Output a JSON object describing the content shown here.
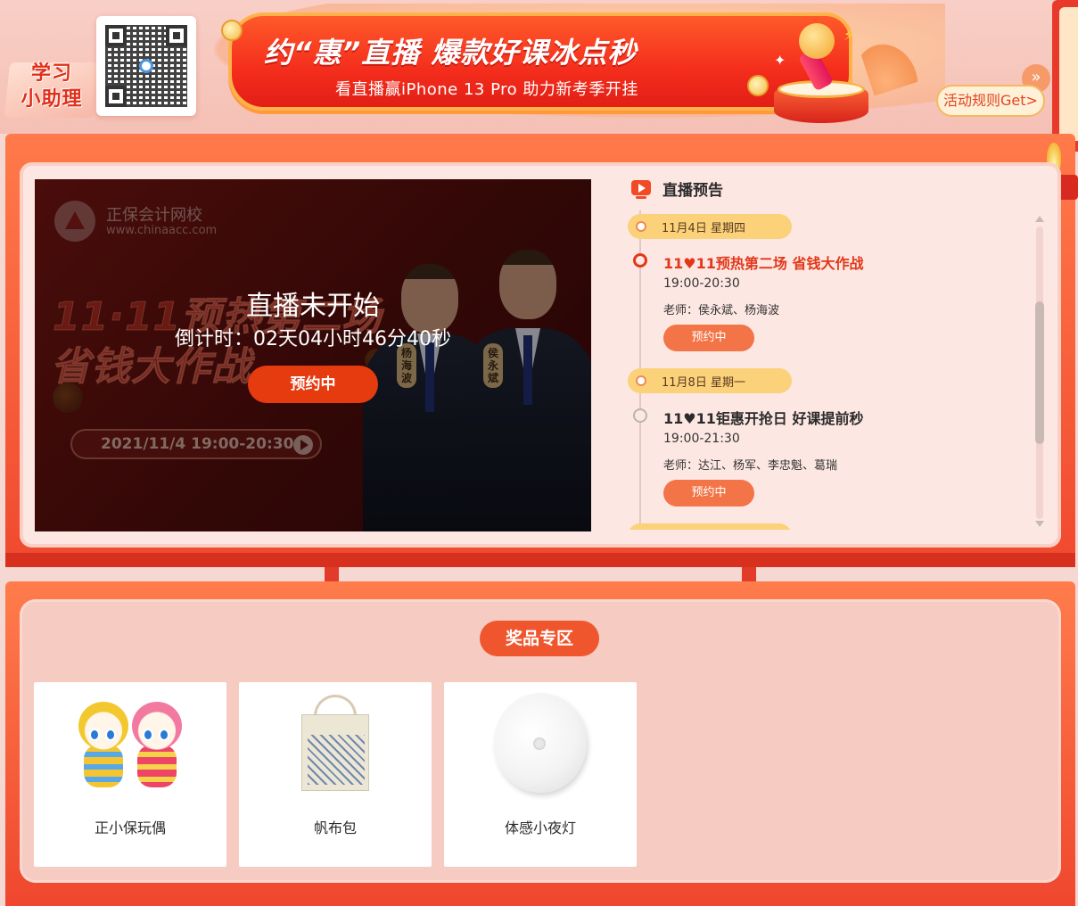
{
  "header": {
    "assistant_label": "学习\n小助理",
    "banner_title": "约“惠”直播 爆款好课冰点秒",
    "banner_subtitle": "看直播赢iPhone 13 Pro 助力新考季开挂",
    "rules_button": "活动规则Get>",
    "rules_arrow": "»"
  },
  "live": {
    "video": {
      "brand": "正保会计网校",
      "url": "www.chinaacc.com",
      "promo_line1": "11·11预热第二场",
      "promo_line2": "省钱大作战",
      "date": "2021/11/4  19:00-20:30",
      "presenter_left": "杨海波",
      "presenter_right": "侯永斌",
      "status_title": "直播未开始",
      "countdown": "倒计时：02天04小时46分40秒",
      "reserve_button": "预约中"
    },
    "schedule": {
      "title": "直播预告",
      "days": [
        {
          "date": "11月4日 星期四",
          "events": [
            {
              "title": "11♥11预热第二场 省钱大作战",
              "time": "19:00-20:30",
              "teachers": "老师：侯永斌、杨海波",
              "button": "预约中",
              "active": true
            }
          ]
        },
        {
          "date": "11月8日 星期一",
          "events": [
            {
              "title": "11♥11钜惠开抢日 好课提前秒",
              "time": "19:00-21:30",
              "teachers": "老师：达江、杨军、李忠魁、葛瑞",
              "button": "预约中",
              "active": false
            }
          ]
        }
      ]
    }
  },
  "prizes": {
    "title": "奖品专区",
    "items": [
      {
        "name": "正小保玩偶",
        "icon": "plush-doll-icon"
      },
      {
        "name": "帆布包",
        "icon": "tote-bag-icon"
      },
      {
        "name": "体感小夜灯",
        "icon": "night-light-icon"
      }
    ]
  },
  "colors": {
    "accent": "#f0562d",
    "active_event": "#e2381a",
    "date_pill": "#fbd27a",
    "panel_bg": "#fde7e3"
  }
}
